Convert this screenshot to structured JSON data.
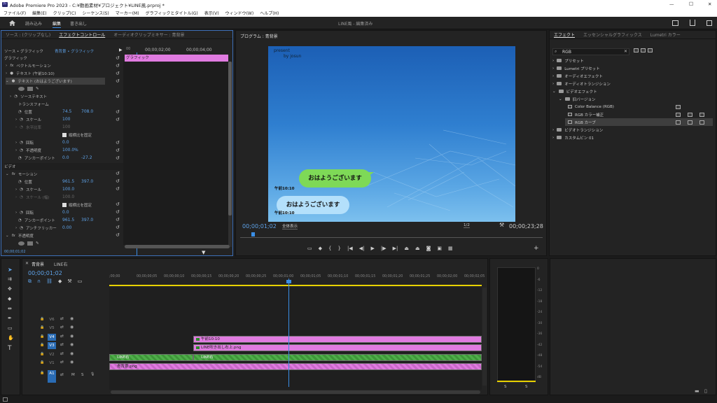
{
  "window": {
    "title": "Adobe Premiere Pro 2023 - C:¥動画素材¥プロジェクト¥LINE風.prproj *",
    "minimize": "—",
    "maximize": "□",
    "close": "✕"
  },
  "menu": [
    "ファイル(F)",
    "編集(E)",
    "クリップ(C)",
    "シーケンス(S)",
    "マーカー(M)",
    "グラフィックとタイトル(G)",
    "表示(V)",
    "ウィンドウ(W)",
    "ヘルプ(H)"
  ],
  "workspace": {
    "tabs": [
      "読み込み",
      "編集",
      "書き出し"
    ],
    "active": "編集",
    "center_title": "LINE風 - 編集済み"
  },
  "effect_controls": {
    "tabs": [
      "ソース : (クリップなし)",
      "エフェクトコントロール",
      "オーディオクリップミキサー : 青背景"
    ],
    "source_row": "ソース • グラフィック",
    "sequence_clip": "青背景 • グラフィック",
    "ruler_start": "00;00;02;00",
    "ruler_end": "00;00;04;00",
    "clip_label": "グラフィック",
    "graphic_header": "グラフィック",
    "vector_motion": "ベクトルモーション",
    "text_layer1": "テキスト (午前10:10)",
    "text_layer2": "テキスト (おはようございます)",
    "source_text": "ソーステキスト",
    "transform": "トランスフォーム",
    "position_label": "位置",
    "position_x": "74.5",
    "position_y": "708.0",
    "scale_label": "スケール",
    "scale_val": "100",
    "scale_w_label": "水平比率",
    "scale_w_val": "100",
    "uniform_label": "縦横比を固定",
    "rotation_label": "回転",
    "rotation_val": "0.0",
    "opacity_label": "不透明度",
    "opacity_val": "100.0",
    "opacity_unit": "%",
    "anchor_label": "アンカーポイント",
    "anchor_x": "0.0",
    "anchor_y": "-27.2",
    "video_header": "ビデオ",
    "motion_label": "モーション",
    "m_position_x": "961.5",
    "m_position_y": "397.0",
    "m_scale": "100.0",
    "m_scale_w_label": "スケール (幅)",
    "m_scale_w": "100.0",
    "m_uniform": "縦横比を固定",
    "m_rotation": "0.0",
    "m_anchor_x": "961.5",
    "m_anchor_y": "397.0",
    "antiflicker_label": "アンチフリッカー",
    "antiflicker_val": "0.00",
    "opacity2_label": "不透明度",
    "timecode": "00;00;01;02"
  },
  "program": {
    "title": "プログラム : 青背景",
    "timecode": "00;00;01;02",
    "duration": "00;00;23;28",
    "fit": "全体表示",
    "quality": "1/2",
    "overlay_line1": "present",
    "overlay_line2": "by josun",
    "bubble_green": "おはようございます",
    "time1": "午前10:10",
    "bubble_blue": "おはようございます",
    "time2": "午前10:10"
  },
  "effects": {
    "tabs": [
      "エフェクト",
      "エッセンシャルグラフィックス",
      "Lumetri カラー"
    ],
    "search": "RGB",
    "tree": [
      {
        "label": "プリセット",
        "depth": 0
      },
      {
        "label": "Lumetri プリセット",
        "depth": 0
      },
      {
        "label": "オーディオエフェクト",
        "depth": 0
      },
      {
        "label": "オーディオトランジション",
        "depth": 0
      },
      {
        "label": "ビデオエフェクト",
        "depth": 0
      },
      {
        "label": "旧バージョン",
        "depth": 1
      },
      {
        "label": "Color Balance (RGB)",
        "depth": 2
      },
      {
        "label": "RGB カラー補正",
        "depth": 2
      },
      {
        "label": "RGB カーブ",
        "depth": 2
      },
      {
        "label": "ビデオトランジション",
        "depth": 0
      },
      {
        "label": "カスタムビン 01",
        "depth": 0
      }
    ]
  },
  "timeline": {
    "tabs": [
      "青背景",
      "LINE右"
    ],
    "timecode": "00;00;01;02",
    "ruler": [
      ";00;00",
      "00;00;00;05",
      "00;00;00;10",
      "00;00;00;15",
      "00;00;00;20",
      "00;00;00;25",
      "00;00;01;00",
      "00;00;01;05",
      "00;00;01;10",
      "00;00;01;15",
      "00;00;01;20",
      "00;00;01;25",
      "00;00;02;00",
      "00;00;02;05"
    ],
    "tracks": [
      "V6",
      "V5",
      "V4",
      "V3",
      "V2",
      "V1",
      "A1"
    ],
    "track_a1_m": "M",
    "track_a1_s": "S",
    "clips": {
      "v4": "午前10:10",
      "v3": "LINE吹き出し右上.png",
      "v2a": "LINE右",
      "v2b": "LINE右",
      "v1": "青背景.png"
    }
  },
  "meter": {
    "scale": [
      "0",
      "-6",
      "-12",
      "-18",
      "-24",
      "-30",
      "-36",
      "-42",
      "-48",
      "-54",
      "dB"
    ],
    "left": "S",
    "right": "S"
  }
}
